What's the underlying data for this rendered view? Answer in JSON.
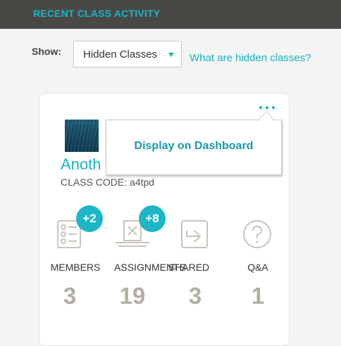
{
  "header": {
    "title": "RECENT CLASS ACTIVITY"
  },
  "filter": {
    "show_label": "Show:",
    "selected": "Hidden Classes",
    "help_link": "What are hidden classes?"
  },
  "class_card": {
    "name": "Anoth",
    "code": "CLASS CODE: a4tpd",
    "menu": {
      "items": [
        "Display on Dashboard"
      ]
    },
    "stats": [
      {
        "icon": "members-list-icon",
        "label": "MEMBERS",
        "value": "3",
        "badge": "+2"
      },
      {
        "icon": "assignments-icon",
        "label": "ASSIGNMENTS",
        "value": "19",
        "badge": "+8"
      },
      {
        "icon": "shared-icon",
        "label": "SHARED",
        "value": "3",
        "badge": ""
      },
      {
        "icon": "qa-icon",
        "label": "Q&A",
        "value": "1",
        "badge": ""
      }
    ]
  },
  "colors": {
    "accent": "#18b5c8",
    "header_bg": "#4a4845",
    "stat_value": "#b3aea3"
  }
}
